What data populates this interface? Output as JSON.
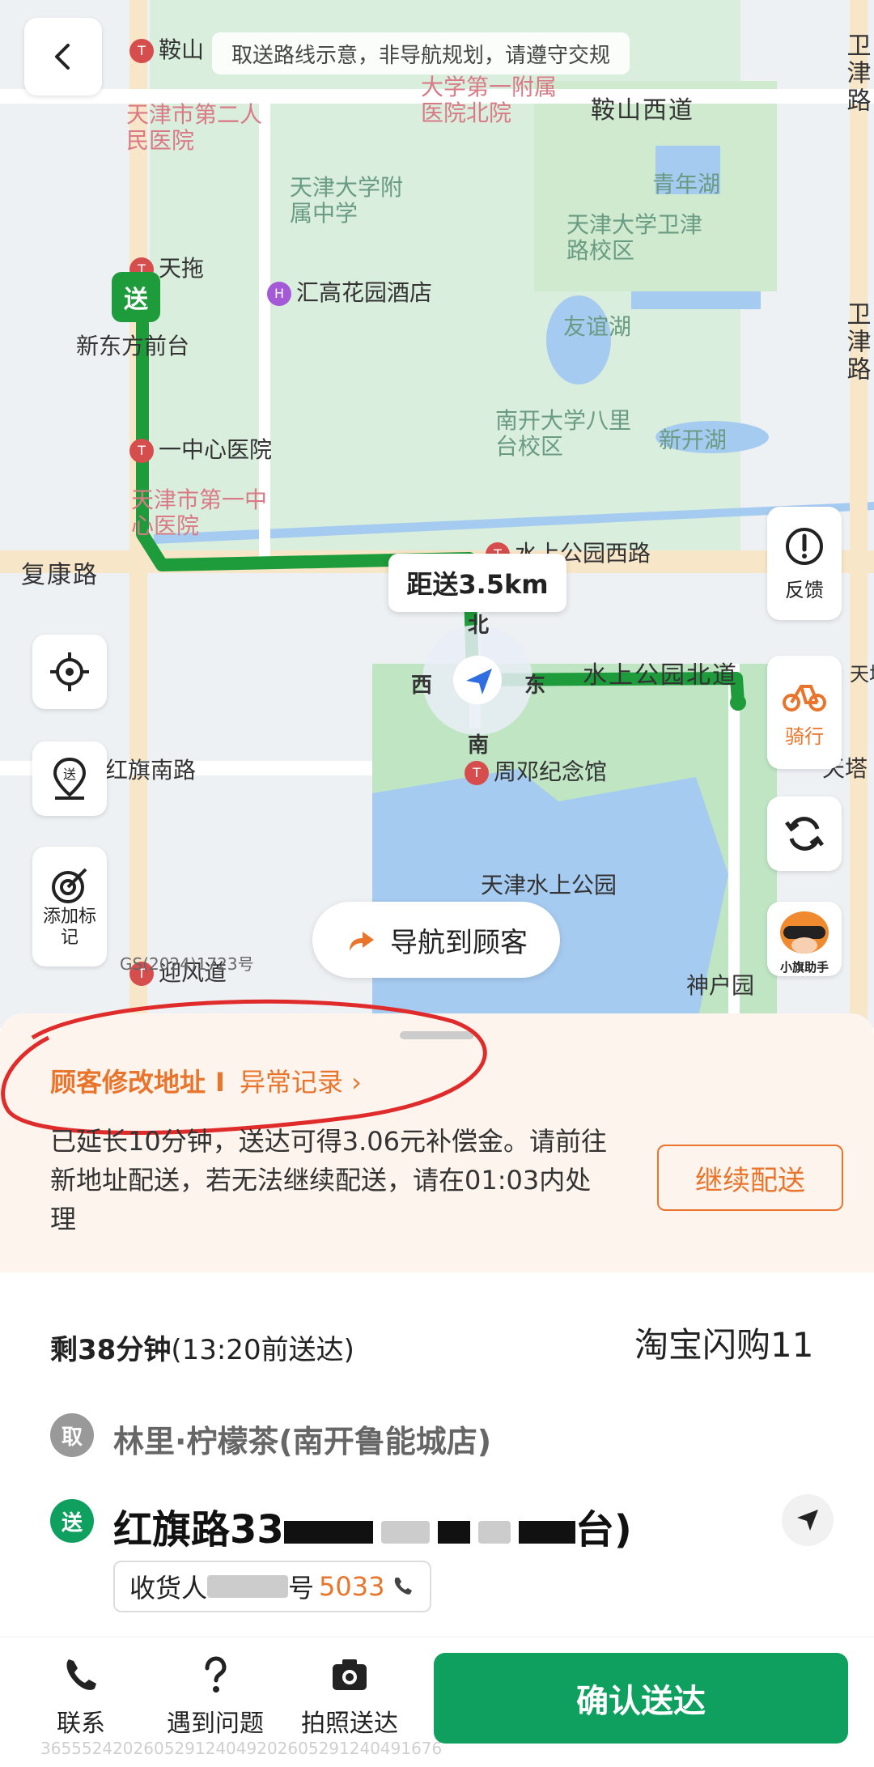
{
  "map": {
    "banner": "取送路线示意，非导航规划，请遵守交规",
    "distance_label": "距送3.5km",
    "compass": {
      "north": "北",
      "south": "南",
      "east": "东",
      "west": "西"
    },
    "labels": {
      "anshan": "鞍山",
      "hospital_north": "大学第一附属医院北院",
      "hospital_2": "天津市第二人民医院",
      "anshan_west_road": "鞍山西道",
      "tianjin_univ_middle": "天津大学附属中学",
      "qingnian_lake": "青年湖",
      "tianjin_univ_weijin": "天津大学卫津路校区",
      "tiantuo": "天拖",
      "huigao_hotel": "汇高花园酒店",
      "youyi_lake": "友谊湖",
      "xindongfang": "新东方前台",
      "weijin_road_top": "卫津路",
      "weijin_road_mid": "卫津路",
      "nankai_univ": "南开大学八里台校区",
      "xinkai_lake": "新开湖",
      "yizhongxin_hospital": "一中心医院",
      "tianjin_first_hospital": "天津市第一中心医院",
      "shuishang_west": "水上公园西路",
      "fukang_road": "复康路",
      "shuishang_north": "水上公园北道",
      "hongqi_south": "红旗南路",
      "zhouden_memorial": "周邓纪念馆",
      "shuishang_park": "天津水上公园",
      "yingfeng": "迎风道",
      "shenhu": "神户园",
      "tianta_1": "天塔",
      "tianta_2": "天塔",
      "gs": "GS(2024)1723号",
      "deliver_pin": "送"
    },
    "buttons": {
      "feedback": "反馈",
      "ride": "骑行",
      "add_mark": "添加标记",
      "navigate": "导航到顾客",
      "assistant": "小旗助手"
    },
    "colors": {
      "route": "#1e9b3a",
      "water": "#a6cbf0",
      "park": "#b9e4bc"
    }
  },
  "alert": {
    "title": "顾客修改地址",
    "separator": "I",
    "record": "异常记录 ›",
    "body": "已延长10分钟，送达可得3.06元补偿金。请前往新地址配送，若无法继续配送，请在01:03内处理",
    "continue": "继续配送",
    "accent": "#e9742b"
  },
  "order": {
    "remain_bold": "剩38分钟",
    "remain_rest": "(13:20前送达)",
    "platform": "淘宝闪购11",
    "pickup_icon": "取",
    "pickup_name": "林里·柠檬茶(南开鲁能城店)",
    "deliver_icon": "送",
    "deliver_prefix": "红旗路33",
    "deliver_suffix": "台)",
    "receiver_prefix": "收货人",
    "receiver_phone_mid": "号",
    "receiver_phone": "5033"
  },
  "bottombar": {
    "contact": "联系",
    "problem": "遇到问题",
    "photo": "拍照送达",
    "confirm": "确认送达"
  },
  "footer_watermark": "365552420260529124049202605291240491676"
}
